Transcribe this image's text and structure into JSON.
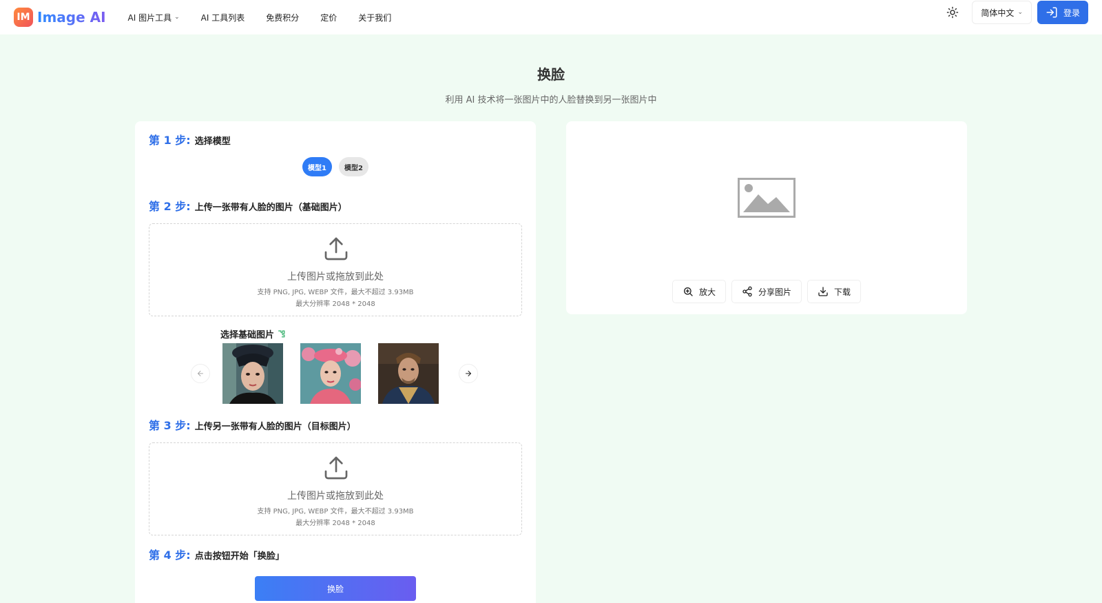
{
  "brand": {
    "badge": "IM",
    "name": "Image AI"
  },
  "nav": [
    {
      "label": "AI 图片工具",
      "has_dropdown": true
    },
    {
      "label": "AI 工具列表",
      "has_dropdown": false
    },
    {
      "label": "免费积分",
      "has_dropdown": false
    },
    {
      "label": "定价",
      "has_dropdown": false
    },
    {
      "label": "关于我们",
      "has_dropdown": false
    }
  ],
  "header": {
    "language": "简体中文",
    "login": "登录"
  },
  "page": {
    "title": "换脸",
    "subtitle": "利用 AI 技术将一张图片中的人脸替换到另一张图片中"
  },
  "steps": [
    {
      "label": "第 1 步:",
      "text": "选择模型"
    },
    {
      "label": "第 2 步:",
      "text": "上传一张带有人脸的图片（基础图片）"
    },
    {
      "label": "第 3 步:",
      "text": "上传另一张带有人脸的图片（目标图片）"
    },
    {
      "label": "第 4 步:",
      "text": "点击按钮开始「换脸」"
    }
  ],
  "models": [
    {
      "label": "模型1",
      "active": true
    },
    {
      "label": "模型2",
      "active": false
    }
  ],
  "upload": {
    "main": "上传图片或拖放到此处",
    "formats": "支持 PNG, JPG, WEBP 文件，最大不超过 3.93MB",
    "resolution": "最大分辨率 2048 * 2048"
  },
  "base_images_label": "选择基础图片",
  "submit_label": "换脸",
  "result_actions": {
    "zoom": "放大",
    "share": "分享图片",
    "download": "下载"
  },
  "colors": {
    "primary": "#2f6fe8",
    "background": "#f0fbf3",
    "card": "#ffffff"
  }
}
